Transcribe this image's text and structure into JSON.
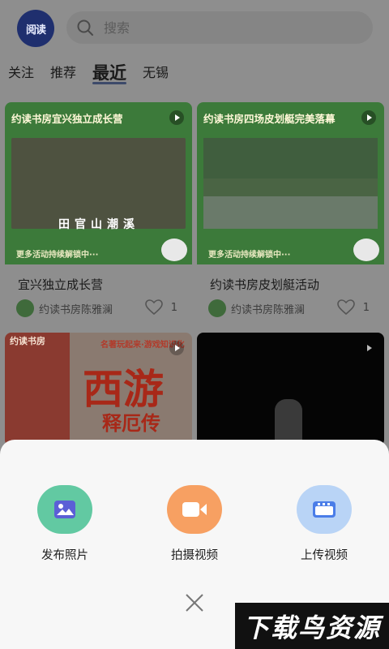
{
  "header": {
    "logo_text": "阅读",
    "search_placeholder": "搜索"
  },
  "tabs": [
    {
      "label": "关注",
      "active": false
    },
    {
      "label": "推荐",
      "active": false
    },
    {
      "label": "最近",
      "active": true
    },
    {
      "label": "无锡",
      "active": false
    }
  ],
  "cards": [
    {
      "cover_title": "约读书房宜兴独立成长营",
      "cover_caption": "田官山潮溪",
      "cover_footer": "更多活动持续解锁中···",
      "title": "宜兴独立成长营",
      "author": "约读书房陈雅澜",
      "likes": "1"
    },
    {
      "cover_title": "约读书房四场皮划艇完美落幕",
      "cover_footer": "更多活动持续解锁中···",
      "title": "约读书房皮划艇活动",
      "author": "约读书房陈雅澜",
      "likes": "1"
    },
    {
      "cover_tag": "约读书房",
      "cover_slogan": "名著玩起来·游戏知识化",
      "cover_title": "西游",
      "cover_subtitle": "释厄传"
    },
    {}
  ],
  "sheet": {
    "actions": [
      {
        "label": "发布照片",
        "icon": "image-icon",
        "color": "#62c9a2"
      },
      {
        "label": "拍摄视频",
        "icon": "video-camera-icon",
        "color": "#f7a062"
      },
      {
        "label": "上传视频",
        "icon": "upload-video-icon",
        "color": "#b9d4f6"
      }
    ]
  },
  "watermark": "下载鸟资源"
}
